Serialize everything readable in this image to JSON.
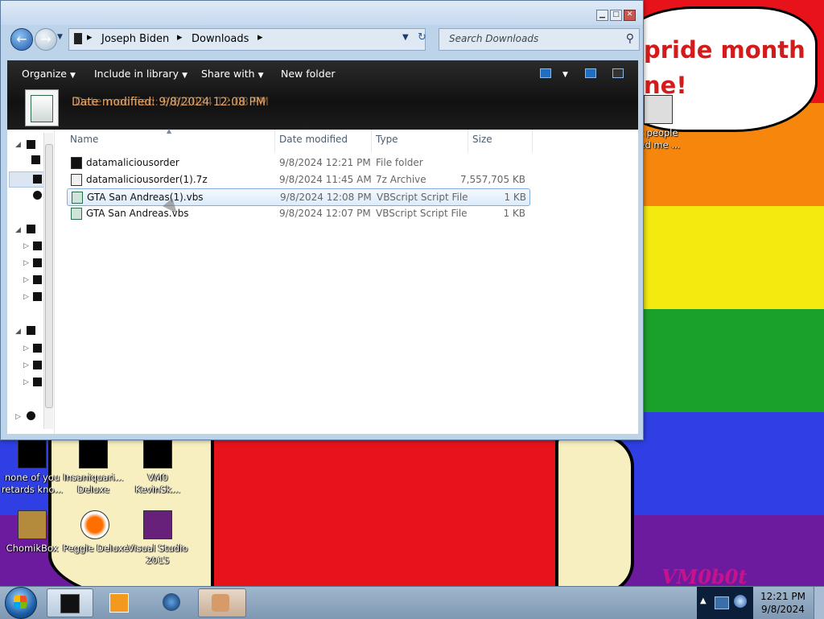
{
  "wallpaper": {
    "speech_text": "pride month\nne!",
    "signature": "VM0b0t"
  },
  "desktop_icons": [
    {
      "label": "nt people\nked me ..."
    },
    {
      "label": "none of you\nretards kno..."
    },
    {
      "label": "Insaniquari...\nDeluxe"
    },
    {
      "label": "VM0\nKevinSk..."
    },
    {
      "label": "ChomikBox"
    },
    {
      "label": "Peggle Deluxe"
    },
    {
      "label": "Visual Studio\n2015"
    }
  ],
  "window": {
    "titlebar_buttons": {
      "minimize": "▁",
      "maximize": "□",
      "close": "✕"
    },
    "breadcrumb": [
      "Joseph Biden",
      "Downloads"
    ],
    "search_placeholder": "Search Downloads",
    "toolbar": {
      "organize": "Organize",
      "include_in_library": "Include in library",
      "share_with": "Share with",
      "new_folder": "New folder"
    },
    "details_preview_text": "Date modified: 9/8/2024 12:08 PM",
    "columns": {
      "name": "Name",
      "date": "Date modified",
      "type": "Type",
      "size": "Size"
    },
    "files": [
      {
        "name": "datamaliciousorder",
        "date": "9/8/2024 12:21 PM",
        "type": "File folder",
        "size": "",
        "icon": "folder-icon"
      },
      {
        "name": "datamaliciousorder(1).7z",
        "date": "9/8/2024 11:45 AM",
        "type": "7z Archive",
        "size": "7,557,705 KB",
        "icon": "archive-icon"
      },
      {
        "name": "GTA San Andreas(1).vbs",
        "date": "9/8/2024 12:08 PM",
        "type": "VBScript Script File",
        "size": "1 KB",
        "icon": "vbs-script-icon",
        "selected": true
      },
      {
        "name": "GTA San Andreas.vbs",
        "date": "9/8/2024 12:07 PM",
        "type": "VBScript Script File",
        "size": "1 KB",
        "icon": "vbs-script-icon"
      }
    ]
  },
  "taskbar": {
    "clock_time": "12:21 PM",
    "clock_date": "9/8/2024",
    "tray_overflow": "▲"
  }
}
